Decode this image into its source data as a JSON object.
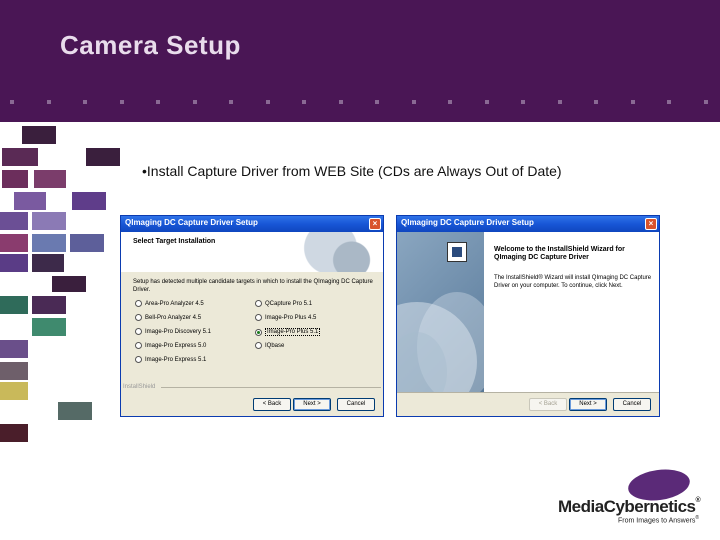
{
  "slide": {
    "title": "Camera Setup",
    "bullet": "•Install Capture Driver from WEB Site (CDs are Always Out of Date)"
  },
  "colors": {
    "header": "#4a1655",
    "title_text": "#e9dcec",
    "accent_purple": "#5b2a78"
  },
  "window_left": {
    "title": "QImaging DC Capture Driver Setup",
    "heading": "Select Target Installation",
    "description": "Setup has detected multiple candidate targets in which to install the QImaging DC Capture Driver.",
    "options_col1": [
      "Area-Pro Analyzer 4.5",
      "Bell-Pro Analyzer 4.5",
      "Image-Pro Discovery 5.1",
      "Image-Pro Express 5.0",
      "Image-Pro Express 5.1"
    ],
    "options_col2": [
      "QCapture Pro 5.1",
      "Image-Pro Plus 4.5",
      "Image-Pro Plus 5.1",
      "IQbase"
    ],
    "selected_option": "Image-Pro Plus 5.1",
    "footer_label": "InstallShield",
    "buttons": {
      "back": "< Back",
      "next": "Next >",
      "cancel": "Cancel"
    }
  },
  "window_right": {
    "title": "QImaging DC Capture Driver Setup",
    "heading": "Welcome to the InstallShield Wizard for QImaging DC Capture Driver",
    "body": "The InstallShield® Wizard will install QImaging DC Capture Driver on your computer. To continue, click Next.",
    "buttons": {
      "back": "< Back",
      "next": "Next >",
      "cancel": "Cancel"
    }
  },
  "logo": {
    "name": "MediaCybernetics",
    "registered": "®",
    "tagline": "From Images to Answers",
    "tagline_mark": "®"
  }
}
